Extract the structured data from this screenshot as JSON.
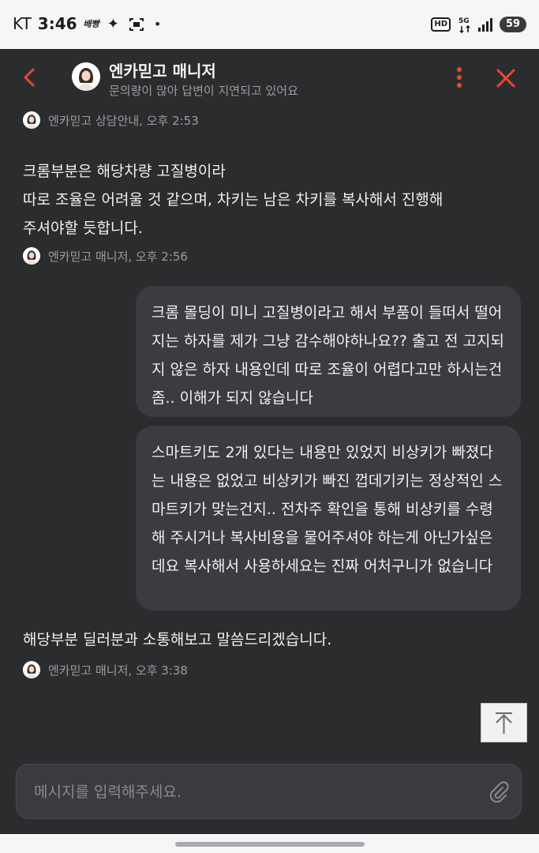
{
  "status_bar": {
    "carrier": "KT",
    "time": "3:46",
    "app_badge": "배빵",
    "hd_label": "HD",
    "network_label": "5G",
    "battery": "59"
  },
  "header": {
    "title": "엔카믿고 매니저",
    "subtitle": "문의량이 많아 답변이 지연되고 있어요"
  },
  "messages": {
    "m1_sender": "엔카믿고 상담안내, 오후 2:53",
    "m2_text": "크롬부분은 해당차량 고질병이라\n따로 조율은 어려울 것 같으며, 차키는 남은 차키를 복사해서 진행해\n주셔야할 듯합니다.",
    "m2_sender": "엔카믿고 매니저, 오후 2:56",
    "m3_text": "크롬 몰딩이 미니 고질병이라고 해서 부품이 들떠서 떨어지는 하자를 제가 그냥 감수해야하나요?? 출고 전 고지되지 않은 하자 내용인데 따로 조율이 어렵다고만 하시는건 좀.. 이해가 되지 않습니다",
    "m4_text": "스마트키도 2개 있다는 내용만 있었지 비상키가 빠졌다는 내용은 없었고 비상키가 빠진 껍데기키는 정상적인 스마트키가 맞는건지.. 전차주 확인을 통해 비상키를 수령해 주시거나 복사비용을 물어주셔야 하는게 아닌가싶은데요 복사해서 사용하세요는 진짜 어처구니가 없습니다",
    "m5_text": "해당부분 딜러분과 소통해보고 말씀드리겠습니다.",
    "m5_sender": "엔카믿고 매니저, 오후 3:38"
  },
  "composer": {
    "placeholder": "메시지를 입력해주세요."
  },
  "colors": {
    "accent": "#e8472e",
    "background": "#2b2c2e",
    "bubble": "#3b3c3f"
  }
}
